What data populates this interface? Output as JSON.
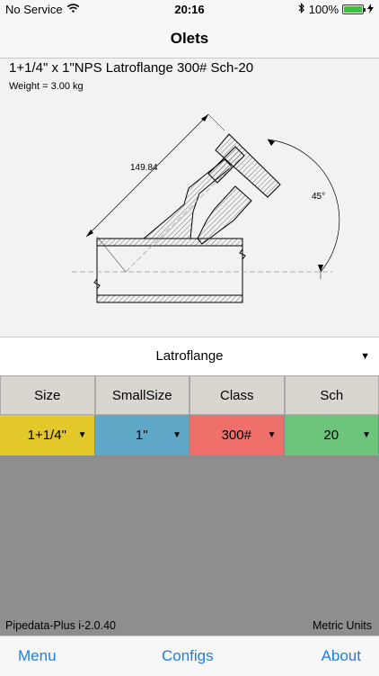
{
  "status": {
    "carrier": "No Service",
    "time": "20:16",
    "battery": "100%",
    "battery_level": 1.0
  },
  "nav": {
    "title": "Olets"
  },
  "info": {
    "title": "1+1/4\" x 1\"NPS Latroflange 300# Sch-20",
    "weight": "Weight = 3.00 kg"
  },
  "drawing": {
    "dimension": "149.84",
    "angle": "45°"
  },
  "type_select": {
    "value": "Latroflange"
  },
  "table": {
    "headers": [
      "Size",
      "SmallSize",
      "Class",
      "Sch"
    ],
    "values": [
      "1+1/4\"",
      "1\"",
      "300#",
      "20"
    ],
    "colors": [
      "#e3c82a",
      "#5fa8c7",
      "#ef6f6b",
      "#6cc57a"
    ]
  },
  "footer": {
    "version": "Pipedata-Plus i-2.0.40",
    "units": "Metric Units"
  },
  "tabs": {
    "menu": "Menu",
    "configs": "Configs",
    "about": "About"
  }
}
